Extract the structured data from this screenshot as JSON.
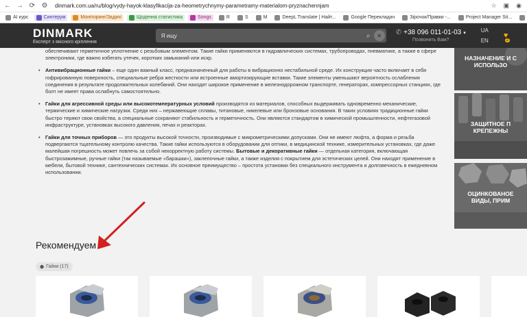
{
  "browser": {
    "url": "dinmark.com.ua/ru/blog/vydy-hayok-klasyfikacija-za-heometrychnymy-parametramy-materialom-pryznachennjam",
    "bookmarks": [
      {
        "label": "AI курс",
        "style": "plain"
      },
      {
        "label": "Синтерум",
        "style": "tag"
      },
      {
        "label": "Моніторинг/Задачі",
        "style": "tag2"
      },
      {
        "label": "Щоденна статистика",
        "style": "tag3"
      },
      {
        "label": "Songs",
        "style": "tag4"
      },
      {
        "label": "R",
        "style": "plain"
      },
      {
        "label": "S",
        "style": "plain"
      },
      {
        "label": "M",
        "style": "plain"
      },
      {
        "label": "DeepL Translate | Найт...",
        "style": "plain"
      },
      {
        "label": "Google Перекладач",
        "style": "plain"
      },
      {
        "label": "Зірочок/Правки -...",
        "style": "plain"
      },
      {
        "label": "Project Manager Sit...",
        "style": "plain"
      },
      {
        "label": "PROJECT",
        "style": "plain"
      }
    ]
  },
  "header": {
    "logo": "DINMARK",
    "tagline": "Експерт з якісного кріплення",
    "search_placeholder": "Я ищу",
    "phone": "+38 096 011-01-03",
    "callback": "Позвонить Вам?",
    "lang_ua": "UA",
    "lang_en": "EN",
    "favorites_count": "2"
  },
  "article": {
    "intro": "обеспечивают герметичное уплотнение с резьбовым элементом. Такие гайки применяются в гидравлических системах, трубопроводах, пневматике, а также в сфере электроники, где важно избегать утечек, коротких замыканий или искр.",
    "items": [
      {
        "bold": "Антивибрационные гайки",
        "text": " – еще один важный класс, предназначенный для работы в вибрационно нестабильной среде. Их конструкция часто включает в себя гофрированную поверхность, специальные ребра жесткости или встроенные амортизирующие вставки. Такие элементы уменьшают вероятность ослабления соединения в результате продолжительных колебаний. Они находят широкое применение в железнодорожном транспорте, генераторах, компрессорных станциях, где болт не имеет права ослабнуть самостоятельно."
      },
      {
        "bold": "Гайки для агрессивной среды или высокотемпературных условий",
        "text": " производятся из материалов, способных выдерживать одновременно механические, термические и химические нагрузки. Среди них – нержавеющие сплавы, титановые, никелевые или бронзовые основания. В таких условиях традиционные гайки быстро теряют свои свойства, а специальные сохраняют стабильность и герметичность. Они являются стандартом в химической промышленности, нефтегазовой инфраструктуре, установках высокого давления, печах и реакторах."
      },
      {
        "bold": "Гайки для точных приборов",
        "text": " — это продукты высокой точности, производимые с микрометрическими допусками. Они не имеют люфта, а форма и резьба подвергаются тщательному контролю качества. Такие гайки используются в оборудовании для оптики, в медицинской технике, измерительных установках, где даже малейшая погрешность может повлечь за собой некорректную работу системы. ",
        "bold2": "Бытовые и декоративные гайки",
        "text2": " — отдельная категория, включающая быстрозажимные, ручные гайки (так называемые «барашки»), заклепочные гайки, а также изделия с покрытием для эстетических целей. Они находят применение в мебели, бытовой технике, сантехнических системах. Их основное преимущество – простота установки без специального инструмента и долговечность в ежедневном использовании."
      }
    ]
  },
  "side_banners": [
    {
      "line1": "НАЗНАЧЕНИЕ И С",
      "line2": "ИСПОЛЬЗО"
    },
    {
      "line1": "ЗАЩИТНОЕ П",
      "line2": "КРЕПЕЖНЫ"
    },
    {
      "line1": "ОЦИНКОВАНОЕ",
      "line2": "ВИДЫ, ПРИМ"
    }
  ],
  "recommend": {
    "title": "Рекомендуем",
    "chip": "Гайки (17)"
  },
  "products": [
    {
      "kind": "nylon-nut"
    },
    {
      "kind": "nylon-nut"
    },
    {
      "kind": "nylon-nut-bronze"
    },
    {
      "kind": "black-hex-nut"
    },
    {
      "kind": "partial"
    }
  ]
}
